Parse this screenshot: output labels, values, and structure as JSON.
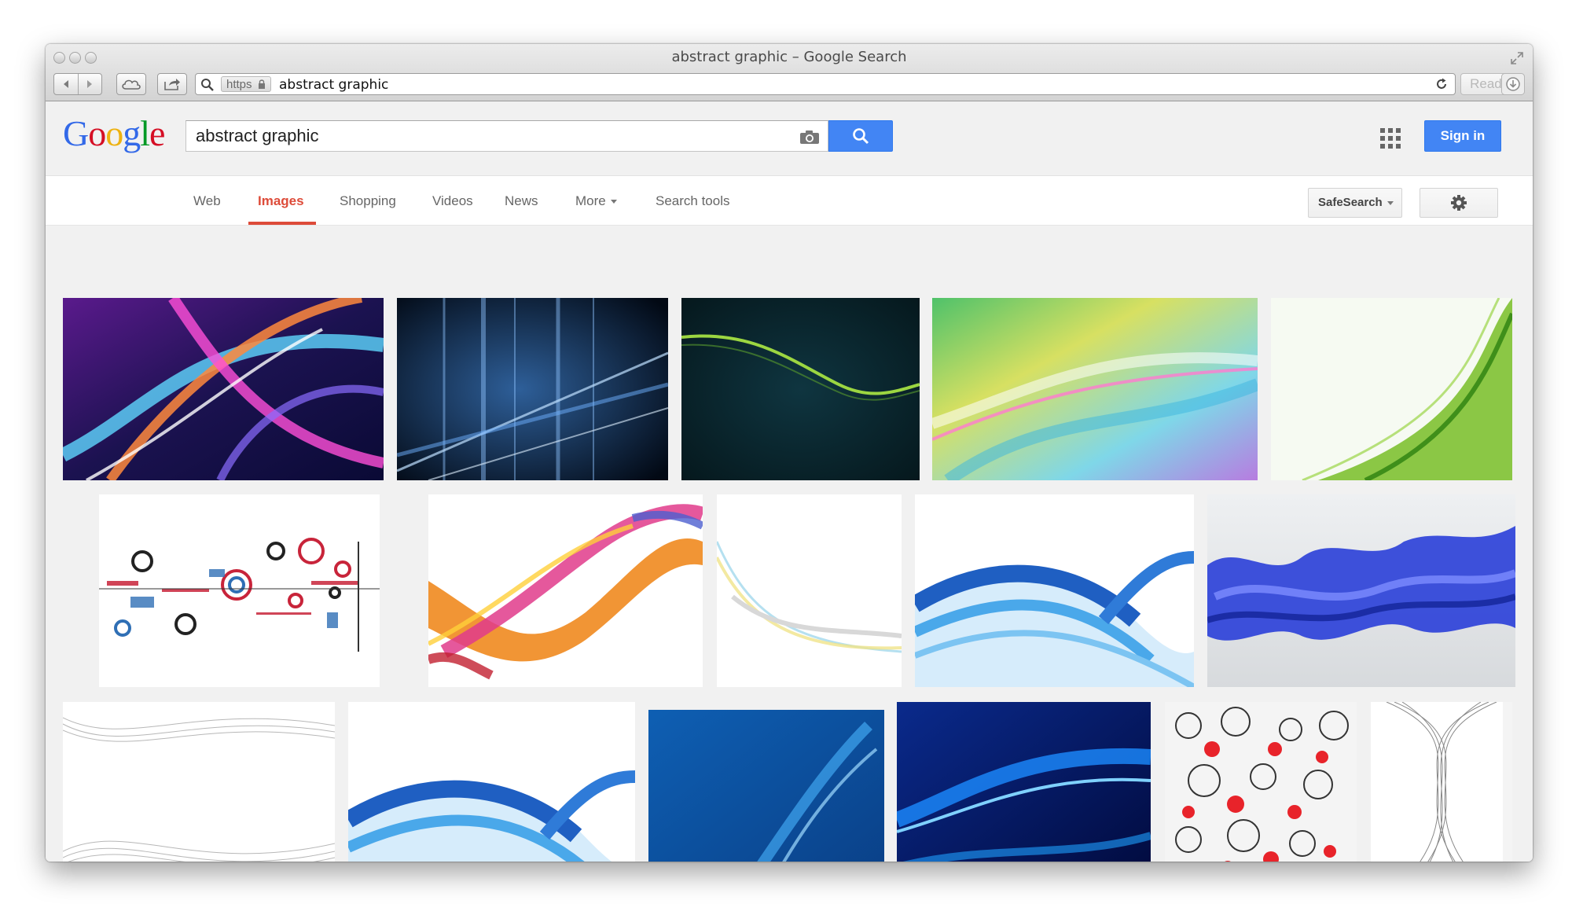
{
  "browser": {
    "window_title": "abstract graphic – Google Search",
    "url_scheme": "https",
    "url_text": "abstract graphic",
    "reader_label": "Reader"
  },
  "google": {
    "logo_letters": [
      "G",
      "o",
      "o",
      "g",
      "l",
      "e"
    ],
    "logo_colors": [
      "#3369e8",
      "#d50f25",
      "#eeb211",
      "#3369e8",
      "#009925",
      "#d50f25"
    ],
    "search_value": "abstract graphic",
    "signin_label": "Sign in",
    "accent_blue": "#4285f4"
  },
  "tabs": {
    "web": "Web",
    "images": "Images",
    "shopping": "Shopping",
    "videos": "Videos",
    "news": "News",
    "more": "More",
    "search_tools": "Search tools",
    "active": "Images",
    "active_color": "#dd4b39"
  },
  "safesearch_label": "SafeSearch",
  "results": {
    "thumbnails": [
      {
        "name": "purple-neon-light-streaks"
      },
      {
        "name": "dark-blue-light-streaks"
      },
      {
        "name": "dark-green-wave-line"
      },
      {
        "name": "pastel-rainbow-waves"
      },
      {
        "name": "green-swoosh-on-white"
      },
      {
        "name": "circles-collage"
      },
      {
        "name": "pink-orange-wave"
      },
      {
        "name": "faint-yellow-blue-lines"
      },
      {
        "name": "blue-wave-with-dots"
      },
      {
        "name": "blue-smoke"
      },
      {
        "name": "grey-wave-lines"
      },
      {
        "name": "blue-wave-with-dots-2"
      },
      {
        "name": "blue-light-streak"
      },
      {
        "name": "deep-blue-wave"
      },
      {
        "name": "black-white-red-pattern"
      },
      {
        "name": "grey-spiral-lines"
      }
    ]
  }
}
